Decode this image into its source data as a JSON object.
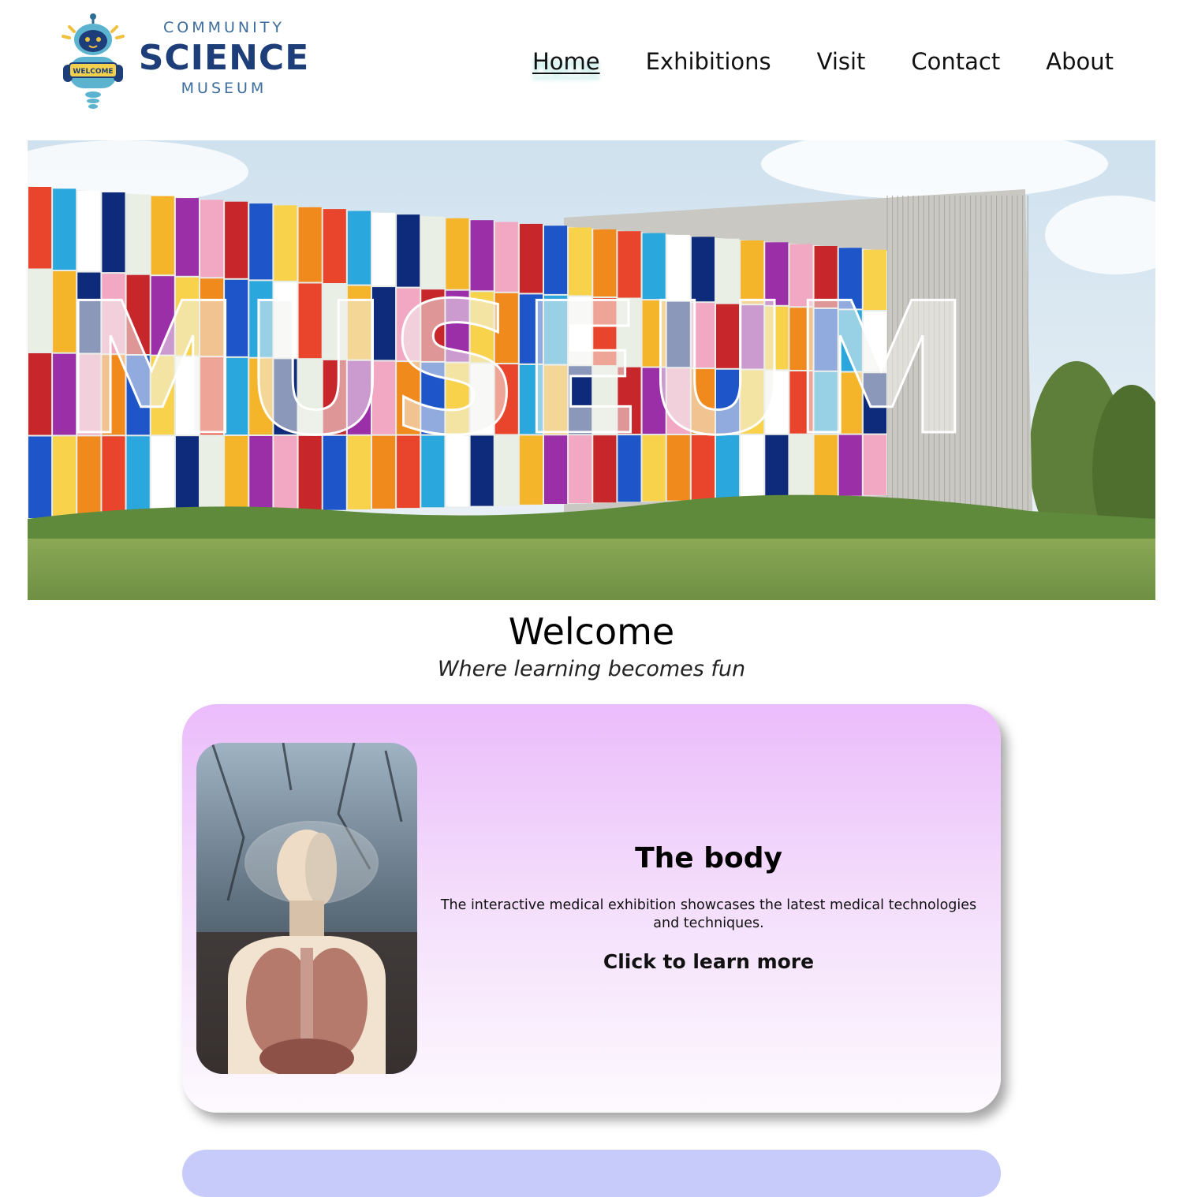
{
  "logo": {
    "line1": "COMMUNITY",
    "line2": "SCIENCE",
    "line3": "MUSEUM",
    "badge": "WELCOME"
  },
  "nav": {
    "items": [
      {
        "label": "Home",
        "active": true
      },
      {
        "label": "Exhibitions"
      },
      {
        "label": "Visit"
      },
      {
        "label": "Contact"
      },
      {
        "label": "About"
      }
    ]
  },
  "hero": {
    "sign_text": "MUSEUM"
  },
  "welcome": {
    "title": "Welcome",
    "subtitle": "Where learning becomes fun"
  },
  "card": {
    "title": "The body",
    "description": "The interactive medical exhibition showcases the latest medical technologies and techniques.",
    "link": "Click to learn more"
  },
  "colors": {
    "brand_navy": "#1d3e79",
    "card_top": "#ebbcfb",
    "next_card": "#c7cbfa"
  }
}
